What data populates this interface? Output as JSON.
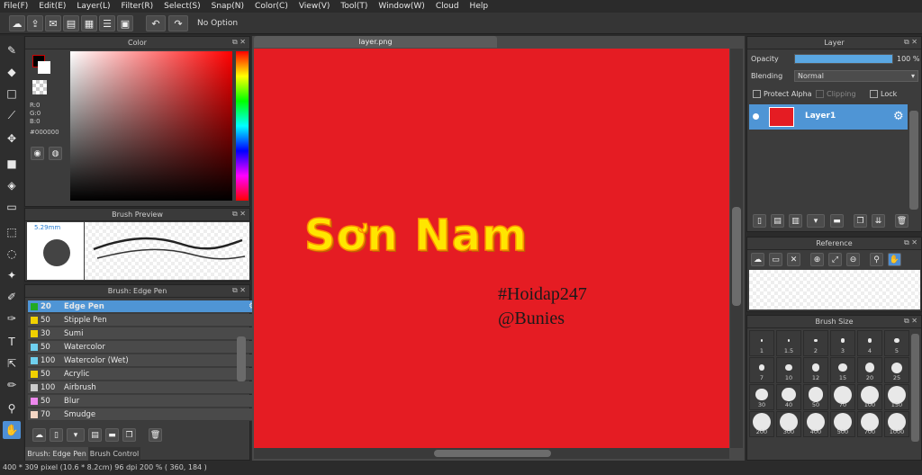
{
  "menu": [
    "File(F)",
    "Edit(E)",
    "Layer(L)",
    "Filter(R)",
    "Select(S)",
    "Snap(N)",
    "Color(C)",
    "View(V)",
    "Tool(T)",
    "Window(W)",
    "Cloud",
    "Help"
  ],
  "toolbar": {
    "option_label": "No Option"
  },
  "color_panel": {
    "title": "Color",
    "r": "R:0",
    "g": "G:0",
    "b": "B:0",
    "hex": "#000000"
  },
  "brush_preview": {
    "title": "Brush Preview",
    "size": "5.29mm"
  },
  "brush_panel": {
    "title": "Brush: Edge Pen",
    "items": [
      {
        "size": "20",
        "name": "Edge Pen",
        "color": "#22aa22",
        "selected": true
      },
      {
        "size": "50",
        "name": "Stipple Pen",
        "color": "#f0d000"
      },
      {
        "size": "30",
        "name": "Sumi",
        "color": "#f0d000"
      },
      {
        "size": "50",
        "name": "Watercolor",
        "color": "#6fd0ef"
      },
      {
        "size": "100",
        "name": "Watercolor (Wet)",
        "color": "#6fd0ef"
      },
      {
        "size": "50",
        "name": "Acrylic",
        "color": "#f0d000"
      },
      {
        "size": "100",
        "name": "Airbrush",
        "color": "#cccccc"
      },
      {
        "size": "50",
        "name": "Blur",
        "color": "#ee88ee"
      },
      {
        "size": "70",
        "name": "Smudge",
        "color": "#f4d6c4"
      }
    ],
    "tabs": [
      "Brush: Edge Pen",
      "Brush Control"
    ]
  },
  "canvas": {
    "tab": "layer.png",
    "title_text": "Sơn Nam",
    "tag1": "#Hoidap247",
    "tag2": "@Bunies",
    "background": "#e51c23",
    "title_color": "#ffe600"
  },
  "layer_panel": {
    "title": "Layer",
    "opacity_label": "Opacity",
    "opacity_value": "100 %",
    "opacity": 1.0,
    "blending_label": "Blending",
    "blending_value": "Normal",
    "protect_alpha": "Protect Alpha",
    "clipping": "Clipping",
    "lock": "Lock",
    "layer_name": "Layer1"
  },
  "reference_panel": {
    "title": "Reference"
  },
  "brush_size_panel": {
    "title": "Brush Size",
    "sizes": [
      "1",
      "1.5",
      "2",
      "3",
      "4",
      "5",
      "7",
      "10",
      "12",
      "15",
      "20",
      "25",
      "30",
      "40",
      "50",
      "70",
      "100",
      "150",
      "200",
      "300",
      "400",
      "500",
      "700",
      "1000"
    ]
  },
  "status": "400 * 309 pixel   (10.6 * 8.2cm)   96 dpi   200 %   ( 360, 184 )"
}
